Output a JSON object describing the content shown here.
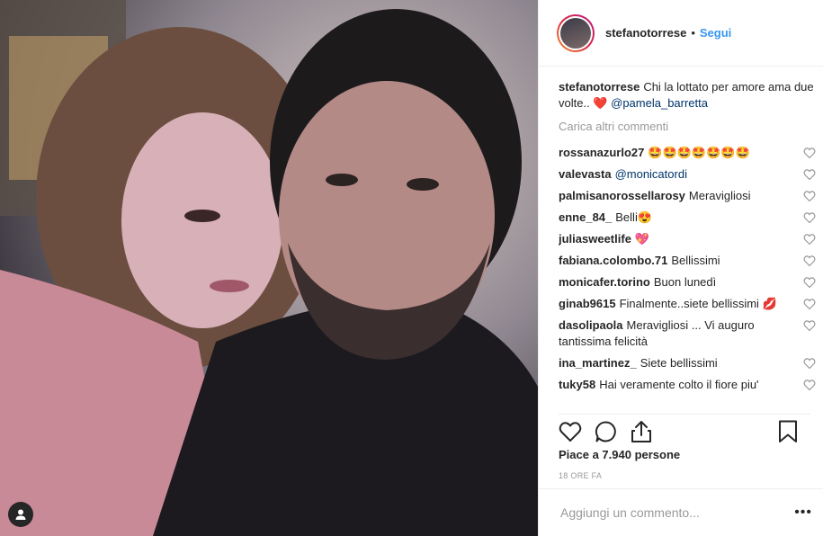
{
  "post": {
    "username": "stefanotorrese",
    "separator": "•",
    "follow_label": "Segui"
  },
  "caption": {
    "username": "stefanotorrese",
    "text": "Chi la lottato per amore ama due volte..",
    "heart": "❤️",
    "mention": "@pamela_barretta"
  },
  "load_more_label": "Carica altri commenti",
  "comments": [
    {
      "user": "rossanazurlo27",
      "text": "🤩🤩🤩🤩🤩🤩🤩"
    },
    {
      "user": "valevasta",
      "text": "@monicatordi",
      "is_mention": true
    },
    {
      "user": "palmisanorossellarosy",
      "text": "Meravigliosi"
    },
    {
      "user": "enne_84_",
      "text": "Belli😍"
    },
    {
      "user": "juliasweetlife",
      "text": "💖"
    },
    {
      "user": "fabiana.colombo.71",
      "text": "Bellissimi"
    },
    {
      "user": "monicafer.torino",
      "text": "Buon lunedì"
    },
    {
      "user": "ginab9615",
      "text": "Finalmente..siete bellissimi 💋"
    },
    {
      "user": "dasolipaola",
      "text": "Meravigliosi ... Vi auguro tantissima felicità"
    },
    {
      "user": "ina_martinez_",
      "text": "Siete bellissimi"
    },
    {
      "user": "tuky58",
      "text": "Hai veramente colto il fiore piu'"
    }
  ],
  "likes_text": "Piace a 7.940 persone",
  "time_text": "18 ORE FA",
  "add_comment_placeholder": "Aggiungi un commento...",
  "more_label": "•••",
  "icons": {
    "like": "heart-icon",
    "comment": "comment-icon",
    "share": "share-icon",
    "save": "bookmark-icon",
    "user_tag": "user-tag-icon"
  }
}
